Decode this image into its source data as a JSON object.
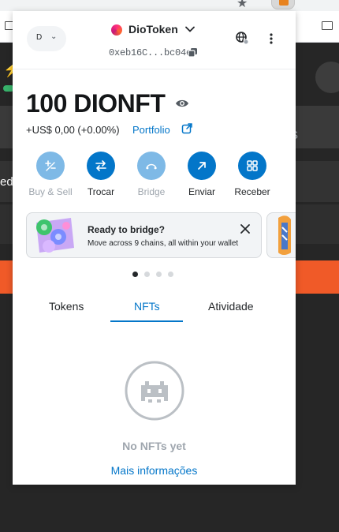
{
  "account": {
    "initial": "D",
    "name": "DioToken",
    "address": "0xeb16C...bc04e"
  },
  "balance": {
    "amount": "100 DIONFT",
    "fiat_change": "+US$ 0,00 (+0.00%)",
    "portfolio_label": "Portfolio"
  },
  "actions": [
    {
      "label": "Buy & Sell",
      "enabled": false
    },
    {
      "label": "Trocar",
      "enabled": true
    },
    {
      "label": "Bridge",
      "enabled": false
    },
    {
      "label": "Enviar",
      "enabled": true
    },
    {
      "label": "Receber",
      "enabled": true
    }
  ],
  "banner": {
    "title": "Ready to bridge?",
    "subtitle": "Move across 9 chains, all within your wallet"
  },
  "carousel": {
    "count": 4,
    "active": 0
  },
  "tabs": [
    {
      "label": "Tokens",
      "active": false
    },
    {
      "label": "NFTs",
      "active": true
    },
    {
      "label": "Atividade",
      "active": false
    }
  ],
  "empty_state": {
    "title": "No NFTs yet",
    "link": "Mais informações"
  },
  "background": {
    "partial_text": "ed"
  },
  "colors": {
    "primary": "#0376c9",
    "primary_disabled": "#7eb9e6",
    "text": "#24272a",
    "muted": "#9fa6ae",
    "background_page": "#262626",
    "accent_orange": "#f05a28"
  },
  "icons": {
    "account_dot": "account-avatar-icon",
    "buy_sell": "plus-minus-icon",
    "swap": "swap-arrows-icon",
    "bridge": "bridge-icon",
    "send": "arrow-up-right-icon",
    "receive": "qr-code-icon",
    "empty_nft": "pixel-alien-icon"
  }
}
